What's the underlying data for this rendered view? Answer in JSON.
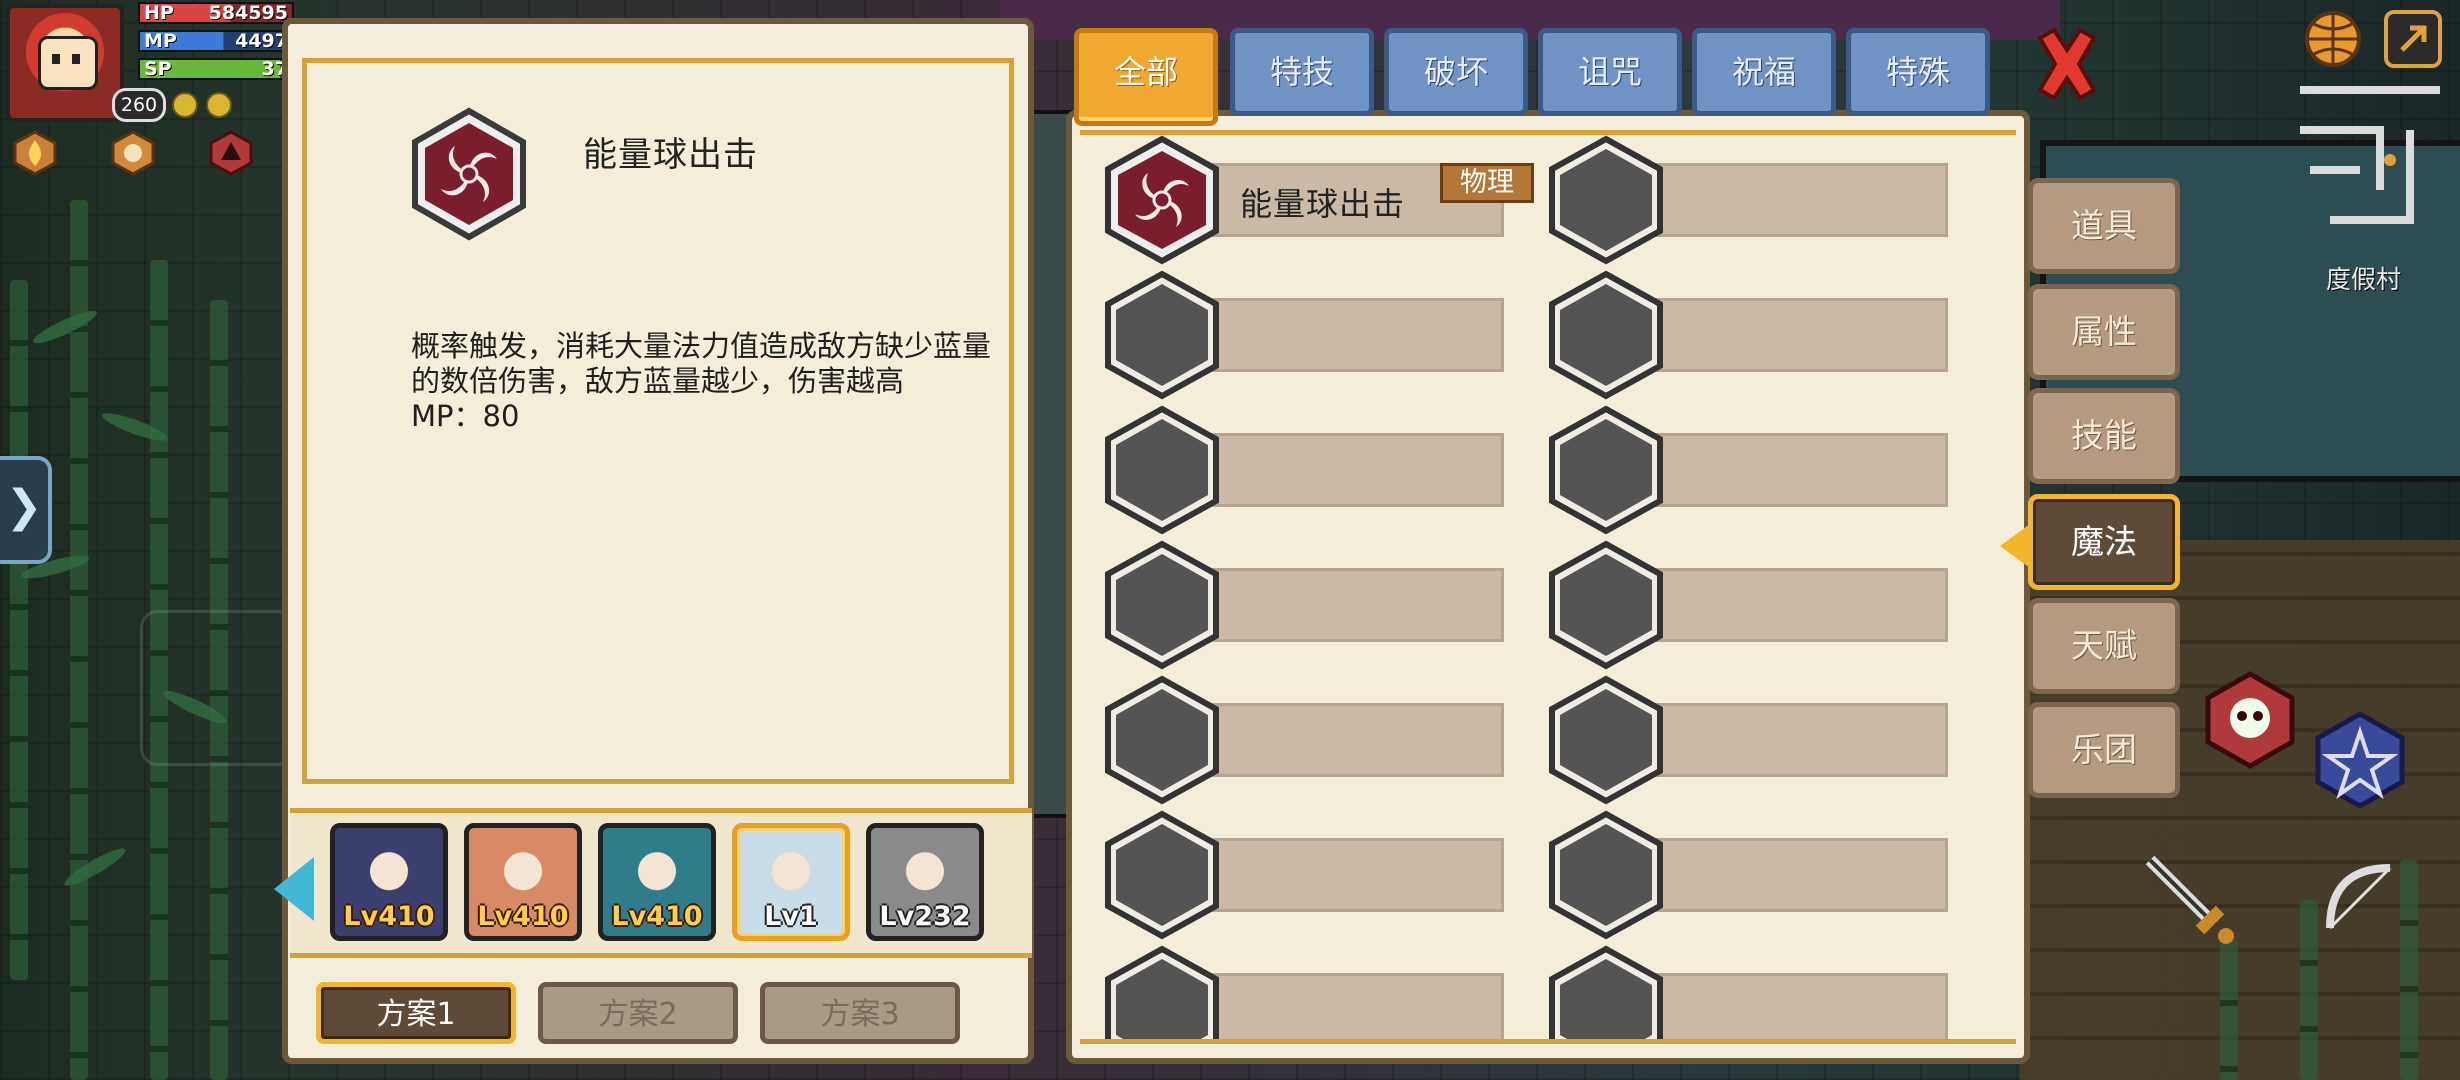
{
  "hud": {
    "hp_label": "HP",
    "hp_value": "584595",
    "mp_label": "MP",
    "mp_value": "4497",
    "sp_label": "SP",
    "sp_value": "37",
    "level": "260"
  },
  "detail": {
    "icon": "energy-swirl-icon",
    "title": "能量球出击",
    "description": "概率触发，消耗大量法力值造成敌方缺少蓝量的数倍伤害，敌方蓝量越少，伤害越高",
    "cost": "MP：80"
  },
  "characters": [
    {
      "level": "Lv410",
      "selected": false,
      "color": "#3b3f6e"
    },
    {
      "level": "Lv410",
      "selected": false,
      "color": "#d88a66"
    },
    {
      "level": "Lv410",
      "selected": false,
      "color": "#2f7c8a"
    },
    {
      "level": "Lv1",
      "selected": true,
      "color": "#c9dde8"
    },
    {
      "level": "Lv232",
      "selected": false,
      "color": "#8a8a8a"
    }
  ],
  "plans": [
    {
      "label": "方案1",
      "selected": true
    },
    {
      "label": "方案2",
      "selected": false
    },
    {
      "label": "方案3",
      "selected": false
    }
  ],
  "tabs": [
    {
      "label": "全部",
      "selected": true
    },
    {
      "label": "特技",
      "selected": false
    },
    {
      "label": "破坏",
      "selected": false
    },
    {
      "label": "诅咒",
      "selected": false
    },
    {
      "label": "祝福",
      "selected": false
    },
    {
      "label": "特殊",
      "selected": false
    }
  ],
  "skill_slots": {
    "first": {
      "name": "能量球出击",
      "tag": "物理"
    }
  },
  "side_tabs": [
    {
      "label": "道具",
      "selected": false
    },
    {
      "label": "属性",
      "selected": false
    },
    {
      "label": "技能",
      "selected": false
    },
    {
      "label": "魔法",
      "selected": true
    },
    {
      "label": "天赋",
      "selected": false
    },
    {
      "label": "乐团",
      "selected": false
    }
  ],
  "map": {
    "location": "度假村"
  },
  "colors": {
    "accent": "#f0a830",
    "panel": "#f4edda",
    "tab_blue": "#6f93c4",
    "frame_gold": "#d3a13a"
  }
}
